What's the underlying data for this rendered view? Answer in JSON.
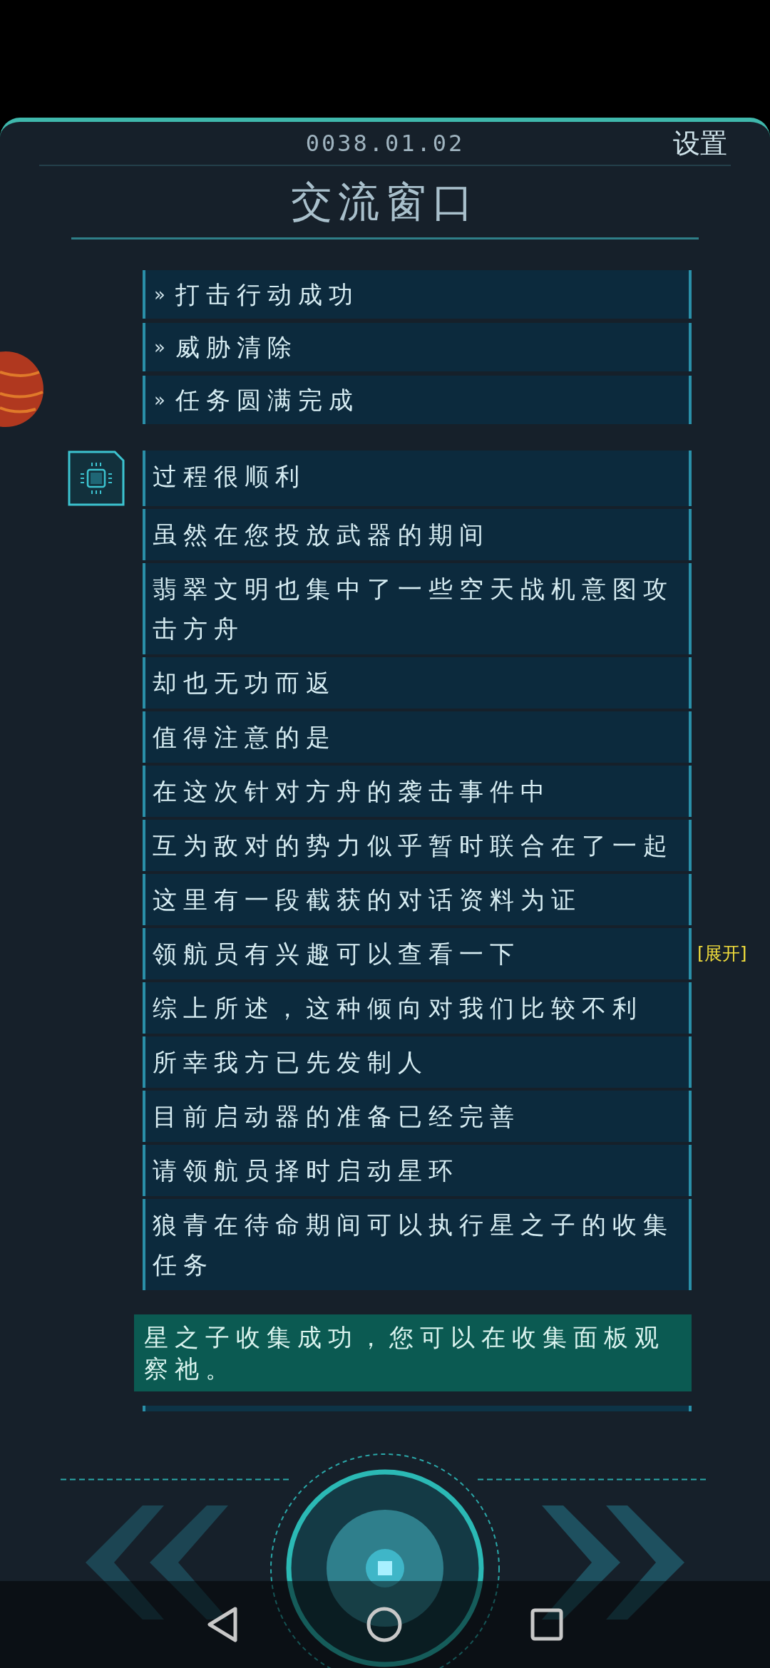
{
  "header": {
    "date": "0038.01.02",
    "settings": "设置",
    "title": "交流窗口"
  },
  "system_messages": [
    {
      "marker": "»",
      "text": "打击行动成功"
    },
    {
      "marker": "»",
      "text": "威胁清除"
    },
    {
      "marker": "»",
      "text": "任务圆满完成"
    }
  ],
  "ai_messages": [
    {
      "text": "过程很顺利"
    },
    {
      "text": "虽然在您投放武器的期间"
    },
    {
      "text": "翡翠文明也集中了一些空天战机意图攻击方舟"
    },
    {
      "text": "却也无功而返"
    },
    {
      "text": "值得注意的是"
    },
    {
      "text": "在这次针对方舟的袭击事件中"
    },
    {
      "text": "互为敌对的势力似乎暂时联合在了一起"
    },
    {
      "text": "这里有一段截获的对话资料为证"
    },
    {
      "text": "领航员有兴趣可以查看一下",
      "expand": "[展开]"
    },
    {
      "text": "综上所述，这种倾向对我们比较不利"
    },
    {
      "text": "所幸我方已先发制人"
    },
    {
      "text": "目前启动器的准备已经完善"
    },
    {
      "text": "请领航员择时启动星环"
    },
    {
      "text": "狼青在待命期间可以执行星之子的收集任务"
    }
  ],
  "notice": "星之子收集成功，您可以在收集面板观察祂。"
}
